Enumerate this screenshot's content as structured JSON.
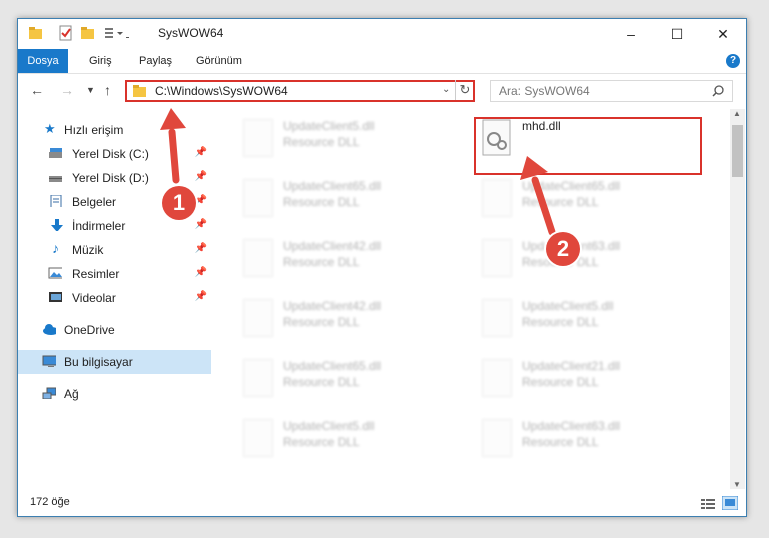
{
  "window": {
    "title": "SysWOW64",
    "minimize": "–",
    "maximize": "☐",
    "close": "✕"
  },
  "ribbon": {
    "tabs": [
      "Dosya",
      "Giriş",
      "Paylaş",
      "Görünüm"
    ],
    "help": "?"
  },
  "address": {
    "path": "C:\\Windows\\SysWOW64",
    "search_placeholder": "Ara: SysWOW64"
  },
  "sidebar": {
    "quick_access": "Hızlı erişim",
    "items": [
      {
        "label": "Yerel Disk (C:)"
      },
      {
        "label": "Yerel Disk (D:)"
      },
      {
        "label": "Belgeler"
      },
      {
        "label": "İndirmeler"
      },
      {
        "label": "Müzik"
      },
      {
        "label": "Resimler"
      },
      {
        "label": "Videolar"
      }
    ],
    "onedrive": "OneDrive",
    "this_pc": "Bu bilgisayar",
    "network": "Ağ"
  },
  "files": {
    "left": [
      {
        "name": "UpdateClient5.dll",
        "type": "Resource DLL"
      },
      {
        "name": "UpdateClient65.dll",
        "type": "Resource DLL"
      },
      {
        "name": "UpdateClient42.dll",
        "type": "Resource DLL"
      },
      {
        "name": "UpdateClient42.dll",
        "type": "Resource DLL"
      },
      {
        "name": "UpdateClient65.dll",
        "type": "Resource DLL"
      },
      {
        "name": "UpdateClient5.dll",
        "type": "Resource DLL"
      }
    ],
    "right": [
      {
        "name": "mhd.dll",
        "type": ""
      },
      {
        "name": "UpdateClient65.dll",
        "type": "Resource DLL"
      },
      {
        "name": "UpdateClient63.dll",
        "type": "Resource DLL"
      },
      {
        "name": "UpdateClient5.dll",
        "type": "Resource DLL"
      },
      {
        "name": "UpdateClient21.dll",
        "type": "Resource DLL"
      },
      {
        "name": "UpdateClient63.dll",
        "type": "Resource DLL"
      }
    ]
  },
  "status": {
    "count": "172 öğe"
  },
  "annotations": {
    "marker1": "1",
    "marker2": "2"
  },
  "colors": {
    "accent": "#1979ca",
    "highlight": "#d9322b"
  }
}
